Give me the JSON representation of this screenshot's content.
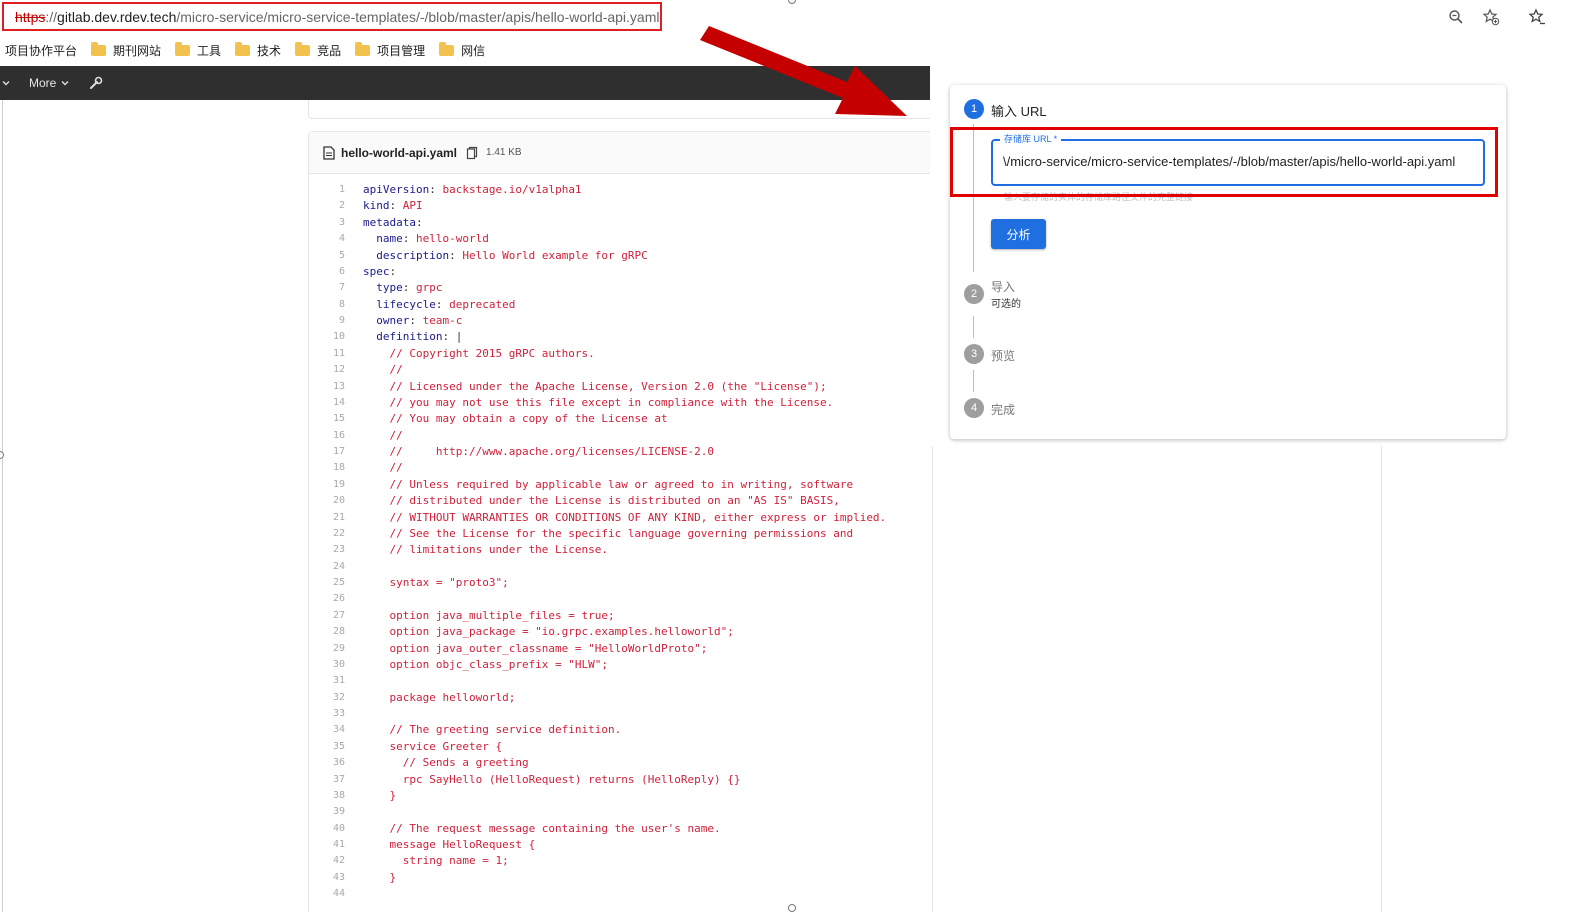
{
  "browser": {
    "url_scheme": "https",
    "url_sep": "://",
    "url_host": "gitlab.dev.rdev.tech",
    "url_path": "/micro-service/micro-service-templates/-/blob/master/apis/hello-world-api.yaml",
    "icons": [
      "zoom-icon",
      "add-favorite-icon",
      "favorites-icon"
    ]
  },
  "bookmarks": {
    "plain": "项目协作平台",
    "folders": [
      "期刊网站",
      "工具",
      "技术",
      "竞品",
      "项目管理",
      "网信"
    ]
  },
  "navbar": {
    "more_label": "More"
  },
  "file": {
    "name": "hello-world-api.yaml",
    "size": "1.41 KB"
  },
  "code_lines": [
    [
      {
        "t": "apiVersion",
        "c": "k"
      },
      {
        "t": ": "
      },
      {
        "t": "backstage.io/v1alpha1",
        "c": "s"
      }
    ],
    [
      {
        "t": "kind",
        "c": "k"
      },
      {
        "t": ": "
      },
      {
        "t": "API",
        "c": "s"
      }
    ],
    [
      {
        "t": "metadata",
        "c": "k"
      },
      {
        "t": ":"
      }
    ],
    [
      {
        "t": "  "
      },
      {
        "t": "name",
        "c": "k"
      },
      {
        "t": ": "
      },
      {
        "t": "hello-world",
        "c": "s"
      }
    ],
    [
      {
        "t": "  "
      },
      {
        "t": "description",
        "c": "k"
      },
      {
        "t": ": "
      },
      {
        "t": "Hello World example for gRPC",
        "c": "s"
      }
    ],
    [
      {
        "t": "spec",
        "c": "k"
      },
      {
        "t": ":"
      }
    ],
    [
      {
        "t": "  "
      },
      {
        "t": "type",
        "c": "k"
      },
      {
        "t": ": "
      },
      {
        "t": "grpc",
        "c": "s"
      }
    ],
    [
      {
        "t": "  "
      },
      {
        "t": "lifecycle",
        "c": "k"
      },
      {
        "t": ": "
      },
      {
        "t": "deprecated",
        "c": "s"
      }
    ],
    [
      {
        "t": "  "
      },
      {
        "t": "owner",
        "c": "k"
      },
      {
        "t": ": "
      },
      {
        "t": "team-c",
        "c": "s"
      }
    ],
    [
      {
        "t": "  "
      },
      {
        "t": "definition",
        "c": "k"
      },
      {
        "t": ": |"
      }
    ],
    [
      {
        "t": "    // Copyright 2015 gRPC authors.",
        "c": "c"
      }
    ],
    [
      {
        "t": "    //",
        "c": "c"
      }
    ],
    [
      {
        "t": "    // Licensed under the Apache License, Version 2.0 (the \"License\");",
        "c": "c"
      }
    ],
    [
      {
        "t": "    // you may not use this file except in compliance with the License.",
        "c": "c"
      }
    ],
    [
      {
        "t": "    // You may obtain a copy of the License at",
        "c": "c"
      }
    ],
    [
      {
        "t": "    //",
        "c": "c"
      }
    ],
    [
      {
        "t": "    //     http://www.apache.org/licenses/LICENSE-2.0",
        "c": "c"
      }
    ],
    [
      {
        "t": "    //",
        "c": "c"
      }
    ],
    [
      {
        "t": "    // Unless required by applicable law or agreed to in writing, software",
        "c": "c"
      }
    ],
    [
      {
        "t": "    // distributed under the License is distributed on an \"AS IS\" BASIS,",
        "c": "c"
      }
    ],
    [
      {
        "t": "    // WITHOUT WARRANTIES OR CONDITIONS OF ANY KIND, either express or implied.",
        "c": "c"
      }
    ],
    [
      {
        "t": "    // See the License for the specific language governing permissions and",
        "c": "c"
      }
    ],
    [
      {
        "t": "    // limitations under the License.",
        "c": "c"
      }
    ],
    [
      {
        "t": ""
      }
    ],
    [
      {
        "t": "    syntax = \"proto3\";",
        "c": "c"
      }
    ],
    [
      {
        "t": ""
      }
    ],
    [
      {
        "t": "    option java_multiple_files = true;",
        "c": "c"
      }
    ],
    [
      {
        "t": "    option java_package = \"io.grpc.examples.helloworld\";",
        "c": "c"
      }
    ],
    [
      {
        "t": "    option java_outer_classname = \"HelloWorldProto\";",
        "c": "c"
      }
    ],
    [
      {
        "t": "    option objc_class_prefix = \"HLW\";",
        "c": "c"
      }
    ],
    [
      {
        "t": ""
      }
    ],
    [
      {
        "t": "    package helloworld;",
        "c": "c"
      }
    ],
    [
      {
        "t": ""
      }
    ],
    [
      {
        "t": "    // The greeting service definition.",
        "c": "c"
      }
    ],
    [
      {
        "t": "    service Greeter {",
        "c": "c"
      }
    ],
    [
      {
        "t": "      // Sends a greeting",
        "c": "c"
      }
    ],
    [
      {
        "t": "      rpc SayHello (HelloRequest) returns (HelloReply) {}",
        "c": "c"
      }
    ],
    [
      {
        "t": "    }",
        "c": "c"
      }
    ],
    [
      {
        "t": ""
      }
    ],
    [
      {
        "t": "    // The request message containing the user's name.",
        "c": "c"
      }
    ],
    [
      {
        "t": "    message HelloRequest {",
        "c": "c"
      }
    ],
    [
      {
        "t": "      string name = 1;",
        "c": "c"
      }
    ],
    [
      {
        "t": "    }",
        "c": "c"
      }
    ],
    [
      {
        "t": ""
      }
    ]
  ],
  "wizard": {
    "step1": {
      "num": "1",
      "label": "输入 URL"
    },
    "field_label": "存储库 URL *",
    "field_value": "\\/micro-service/micro-service-templates/-/blob/master/apis/hello-world-api.yaml",
    "helper_text": "输入要存储的实体的存储库路径文件的完整链接",
    "analyze_label": "分析",
    "step2": {
      "num": "2",
      "label": "导入",
      "sub": "可选的"
    },
    "step3": {
      "num": "3",
      "label": "预览"
    },
    "step4": {
      "num": "4",
      "label": "完成"
    }
  },
  "colors": {
    "highlight_red": "#e00000",
    "arrow_red": "#c40000",
    "accent_blue": "#1f6fe0",
    "navbar": "#2f2f2f"
  }
}
